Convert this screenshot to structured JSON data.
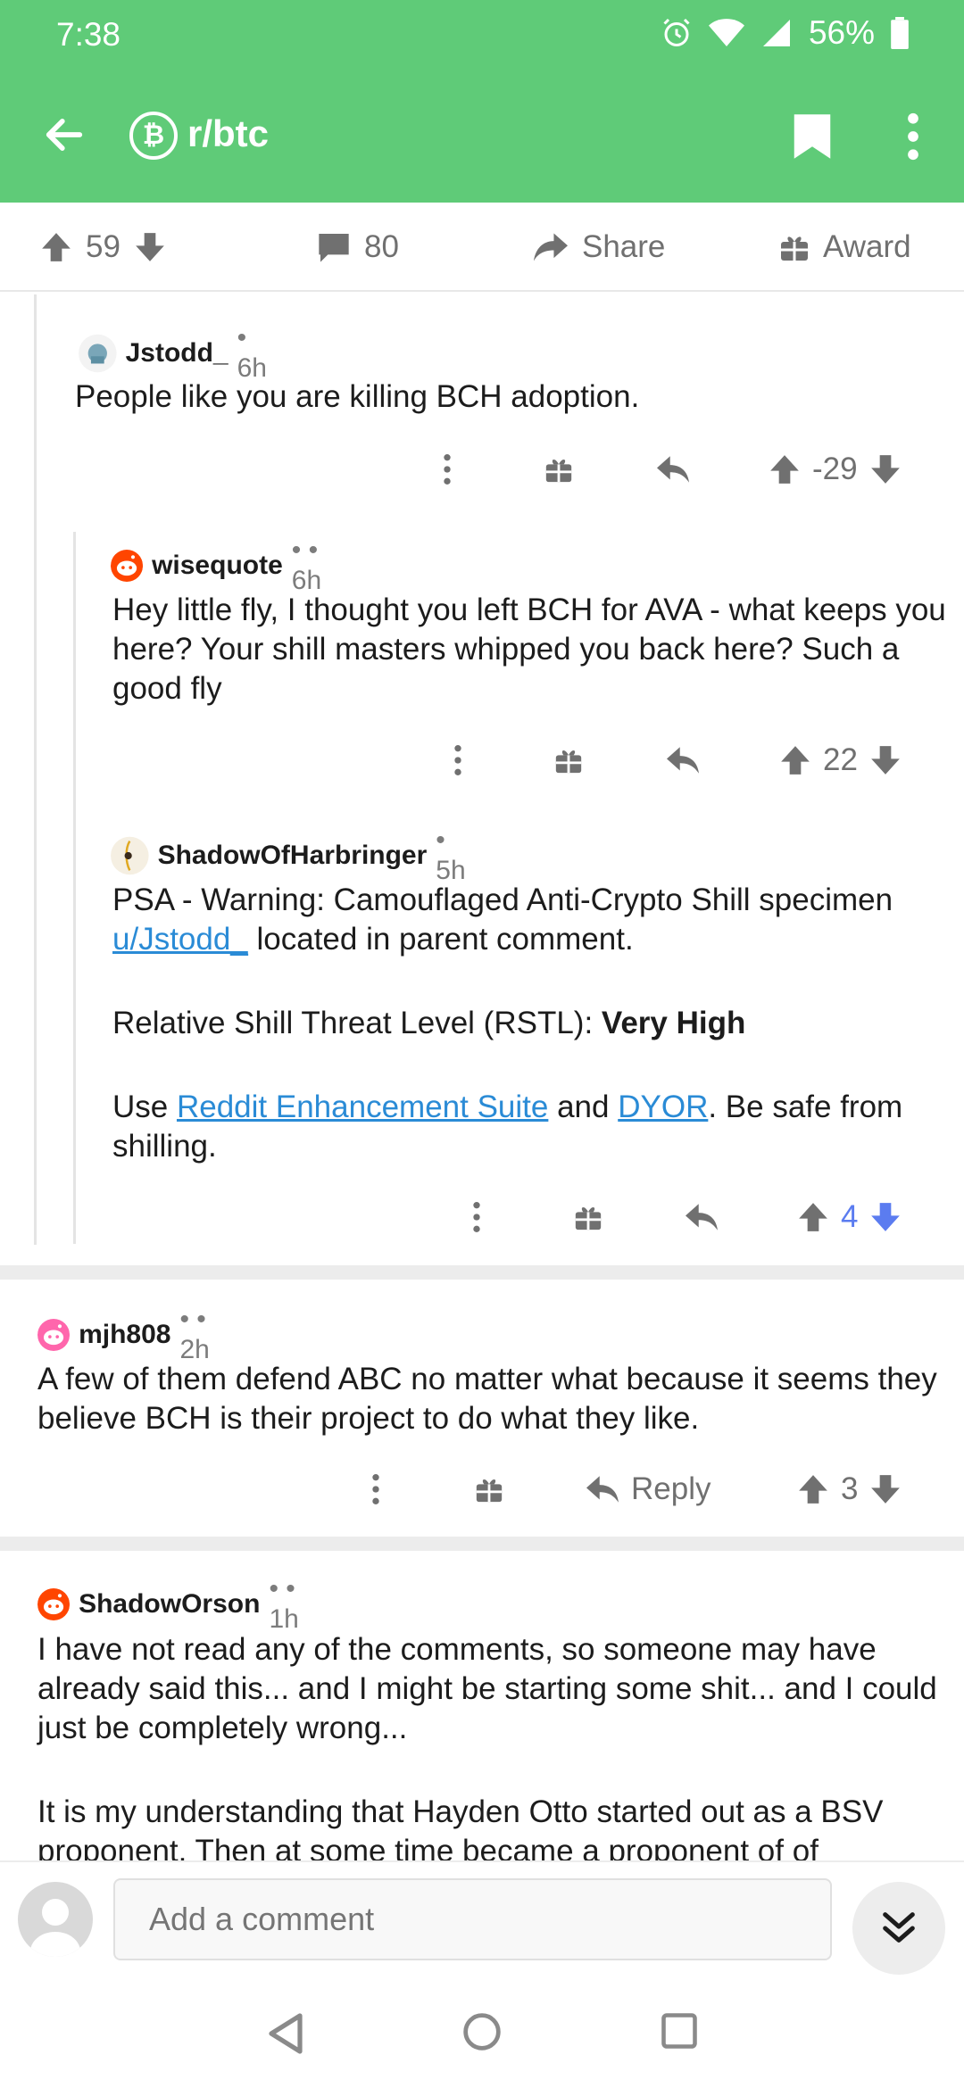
{
  "status": {
    "time": "7:38",
    "battery": "56%"
  },
  "toolbar": {
    "subreddit": "r/btc",
    "sub_glyph": "₿"
  },
  "post_actions": {
    "upvotes": "59",
    "comments": "80",
    "share_label": "Share",
    "award_label": "Award"
  },
  "comments": [
    {
      "author": "Jstodd_",
      "meta": "• 6h",
      "body": "People like you are killing BCH adoption.",
      "score": "-29"
    },
    {
      "author": "wisequote",
      "meta": "•  • 6h",
      "body": "Hey little fly, I thought you left BCH for AVA - what keeps you here? Your shill masters whipped you back here? Such a good fly",
      "score": "22"
    },
    {
      "author": "ShadowOfHarbringer",
      "meta": "• 5h",
      "body_p1_before": "PSA - Warning: Camouflaged Anti-Crypto Shill specimen",
      "body_p1_link": "u/Jstodd_",
      "body_p1_after": " located in parent comment.",
      "body_p2_label": "Relative Shill Threat Level (RSTL): ",
      "body_p2_value": "Very High",
      "body_p3_before": "Use ",
      "body_p3_link1": "Reddit Enhancement Suite",
      "body_p3_mid": " and ",
      "body_p3_link2": "DYOR",
      "body_p3_after": ". Be safe from shilling.",
      "score": "4"
    },
    {
      "author": "mjh808",
      "meta": "•  • 2h",
      "body": "A few of them defend ABC no matter what because it seems they believe BCH is their project to do what they like.",
      "reply_label": "Reply",
      "score": "3"
    },
    {
      "author": "ShadowOrson",
      "meta": "•  • 1h",
      "body_p1": "I have not read any of the comments, so someone may have already said this... and I might be starting some shit... and I could just be completely wrong...",
      "body_p2": "It is my understanding that Hayden Otto started out as a BSV proponent. Then at some time became a proponent of of"
    }
  ],
  "composer": {
    "placeholder": "Add a comment"
  },
  "colors": {
    "header": "#5fcb78",
    "link": "#2a8bd6",
    "upvoted": "#5b7cf0",
    "icon_gray": "#707070"
  }
}
